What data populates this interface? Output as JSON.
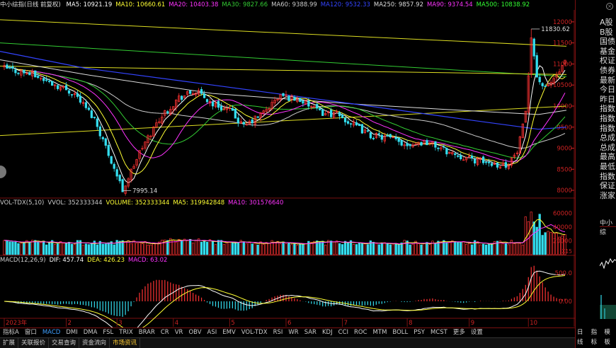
{
  "colors": {
    "ma5": "#ffffff",
    "ma10": "#ffff33",
    "ma20": "#ff33ff",
    "ma30": "#33cc33",
    "ma60": "#cccccc",
    "ma120": "#3344ff",
    "ma250": "#dddddd",
    "ma90": "#ff33ff",
    "ma500": "#33ff33",
    "up": "#ff3333",
    "down": "#33ddee",
    "axis_label": "#cc2222",
    "diff": "#ffffff",
    "dea": "#ffff33"
  },
  "title": {
    "name": "中小综指(日线 前复权)"
  },
  "ma_legend": [
    {
      "label": "MA5: 10921.19",
      "color": "#ffffff"
    },
    {
      "label": "MA10: 10660.61",
      "color": "#ffff33"
    },
    {
      "label": "MA20: 10403.38",
      "color": "#ff33ff"
    },
    {
      "label": "MA30: 9827.66",
      "color": "#33cc33"
    },
    {
      "label": "MA60: 9388.99",
      "color": "#cccccc"
    },
    {
      "label": "MA120: 9532.33",
      "color": "#3344ff"
    },
    {
      "label": "MA250: 9857.92",
      "color": "#dddddd"
    },
    {
      "label": "MA90: 9374.54",
      "color": "#ff33ff"
    },
    {
      "label": "MA500: 10838.92",
      "color": "#33ff33"
    }
  ],
  "price_axis": [
    "12000",
    "11500",
    "11000",
    "10500",
    "10000",
    "9500",
    "9000",
    "8500",
    "8000"
  ],
  "annotations": {
    "high": "11830.62",
    "low": "7995.14"
  },
  "volume_legend": [
    {
      "label": "VOL-TDX(5,10)",
      "color": "#cccccc"
    },
    {
      "label": "VVOL: 352333344",
      "color": "#cccccc"
    },
    {
      "label": "VOLUME: 352333344",
      "color": "#ffff33"
    },
    {
      "label": "MA5: 319942848",
      "color": "#ffff33"
    },
    {
      "label": "MA10: 301576640",
      "color": "#ff33ff"
    }
  ],
  "volume_axis": [
    "60000",
    "40000",
    "20000"
  ],
  "volume_unit": "X15",
  "macd_legend": [
    {
      "label": "MACD(12,26,9)",
      "color": "#cccccc"
    },
    {
      "label": "DIF: 457.74",
      "color": "#ffffff"
    },
    {
      "label": "DEA: 426.23",
      "color": "#ffff33"
    },
    {
      "label": "MACD: 63.02",
      "color": "#ff33ff"
    }
  ],
  "macd_axis": [
    "500.0",
    "0.00"
  ],
  "x_axis": [
    "2023年",
    "2",
    "3",
    "4",
    "5",
    "6",
    "7",
    "8",
    "9",
    "10"
  ],
  "right_list": [
    "A股",
    "B股",
    "国债",
    "基金",
    "权证",
    "债券",
    "最新",
    "今日",
    "昨日",
    "指数",
    "指数",
    "指数",
    "总成",
    "总成",
    "最高",
    "最低",
    "指数",
    "保证",
    "涨家"
  ],
  "right_panel": {
    "title": "中小综",
    "bottom_label": "日线",
    "bottom_tabs": [
      "指标",
      "模板"
    ]
  },
  "indicator_tabs": [
    "指标A",
    "窗口",
    "MACD",
    "DMI",
    "DMA",
    "FSL",
    "TRIX",
    "BRAR",
    "CR",
    "VR",
    "OBV",
    "ASI",
    "EMV",
    "VOL-TDX",
    "RSI",
    "WR",
    "SAR",
    "KDJ",
    "CCI",
    "ROC",
    "MTM",
    "BOLL",
    "PSY",
    "MCST",
    "更多",
    "设置"
  ],
  "bottom_tabs": [
    "扩展",
    "关联报价",
    "交易查询",
    "资金流向",
    "市场资讯"
  ]
}
